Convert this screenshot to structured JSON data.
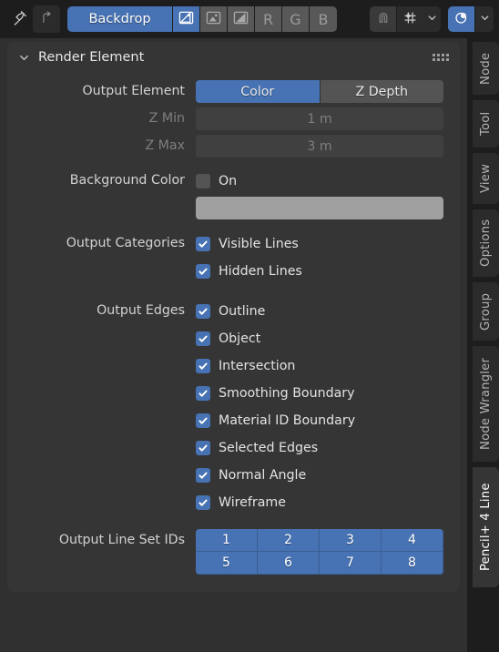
{
  "topbar": {
    "pin_icon": "pin-icon",
    "parent_node_tree_icon": "up-arrow-icon",
    "backdrop_label": "Backdrop",
    "channels": [
      {
        "name": "color-and-alpha-channel",
        "label": "",
        "icon": "image-color-alpha-icon",
        "active": true
      },
      {
        "name": "color-channel",
        "label": "",
        "icon": "image-color-icon",
        "active": false
      },
      {
        "name": "alpha-channel",
        "label": "",
        "icon": "image-alpha-icon",
        "active": false
      },
      {
        "name": "red-channel",
        "label": "R",
        "icon": "",
        "active": false
      },
      {
        "name": "green-channel",
        "label": "G",
        "icon": "",
        "active": false
      },
      {
        "name": "blue-channel",
        "label": "B",
        "icon": "",
        "active": false
      }
    ],
    "snap_icon": "magnet-icon",
    "snap_target_icon": "snap-grid-icon",
    "snap_dropdown_icon": "chevron-down-icon",
    "proportional_icon": "proportional-editing-icon",
    "proportional_dropdown_icon": "chevron-down-icon",
    "accent_color": "#4772b3"
  },
  "panel": {
    "collapse_icon": "chevron-down-icon",
    "title": "Render Element",
    "grip_icon": "drag-grip-icon"
  },
  "properties": {
    "output_element": {
      "label": "Output Element",
      "options": [
        {
          "label": "Color",
          "selected": true
        },
        {
          "label": "Z Depth",
          "selected": false
        }
      ]
    },
    "z_min": {
      "label": "Z Min",
      "value": "1 m",
      "disabled": true
    },
    "z_max": {
      "label": "Z Max",
      "value": "3 m",
      "disabled": true
    },
    "background_color": {
      "label": "Background Color",
      "toggle_label": "On",
      "toggle_checked": false,
      "swatch_color": "#a0a0a0"
    },
    "output_categories": {
      "label": "Output Categories",
      "items": [
        {
          "label": "Visible Lines",
          "checked": true
        },
        {
          "label": "Hidden Lines",
          "checked": true
        }
      ]
    },
    "output_edges": {
      "label": "Output Edges",
      "items": [
        {
          "label": "Outline",
          "checked": true
        },
        {
          "label": "Object",
          "checked": true
        },
        {
          "label": "Intersection",
          "checked": true
        },
        {
          "label": "Smoothing Boundary",
          "checked": true
        },
        {
          "label": "Material ID Boundary",
          "checked": true
        },
        {
          "label": "Selected Edges",
          "checked": true
        },
        {
          "label": "Normal Angle",
          "checked": true
        },
        {
          "label": "Wireframe",
          "checked": true
        }
      ]
    },
    "output_line_set_ids": {
      "label": "Output Line Set IDs",
      "ids": [
        {
          "label": "1",
          "active": true
        },
        {
          "label": "2",
          "active": true
        },
        {
          "label": "3",
          "active": true
        },
        {
          "label": "4",
          "active": true
        },
        {
          "label": "5",
          "active": true
        },
        {
          "label": "6",
          "active": true
        },
        {
          "label": "7",
          "active": true
        },
        {
          "label": "8",
          "active": true
        }
      ]
    }
  },
  "sidebar_tabs": [
    {
      "label": "Node",
      "active": false
    },
    {
      "label": "Tool",
      "active": false
    },
    {
      "label": "View",
      "active": false
    },
    {
      "label": "Options",
      "active": false
    },
    {
      "label": "Group",
      "active": false
    },
    {
      "label": "Node Wrangler",
      "active": false
    },
    {
      "label": "Pencil+ 4 Line",
      "active": true
    }
  ]
}
